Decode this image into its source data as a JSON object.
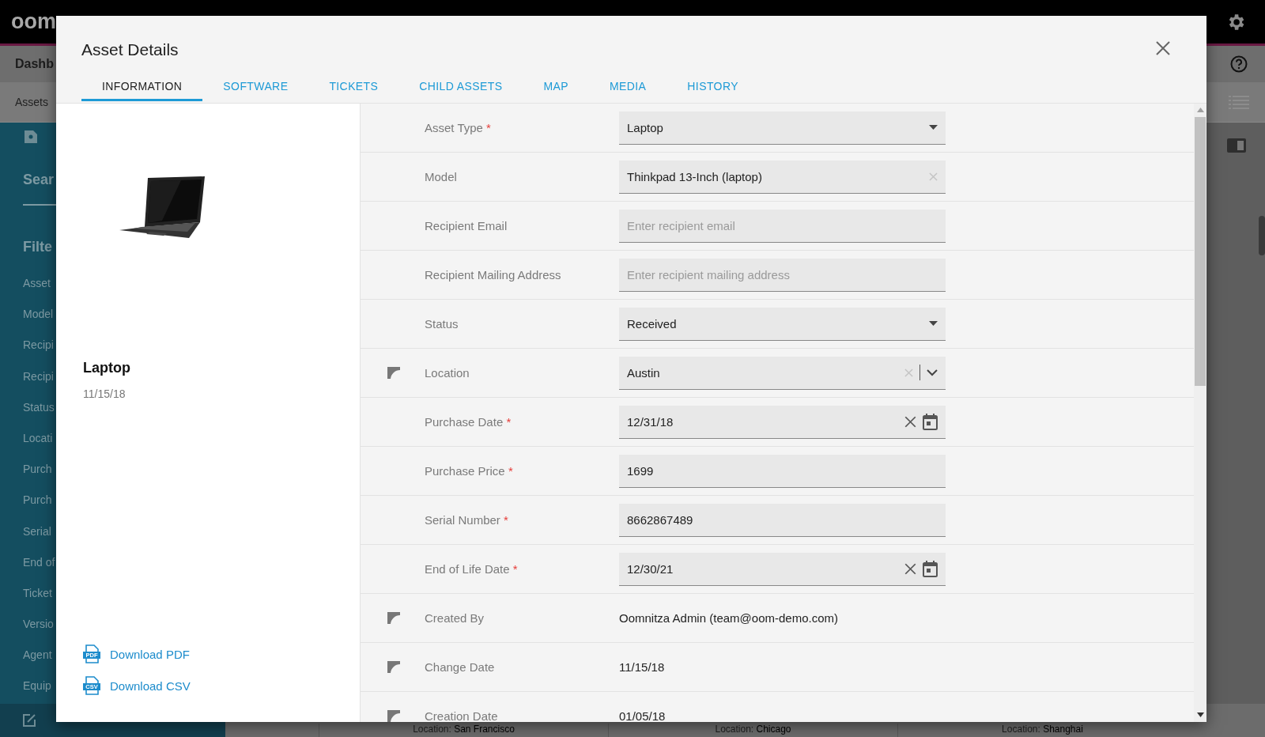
{
  "background": {
    "logo": "oom",
    "header_title": "Dashb",
    "breadcrumb": "Assets",
    "sidebar": {
      "search_heading": "Sear",
      "filter_heading": "Filte",
      "items": [
        "Asset",
        "Model",
        "Recipi",
        "Recipi",
        "Status",
        "Locati",
        "Purch",
        "Purch",
        "Serial",
        "End of",
        "Ticket",
        "Versio",
        "Agent",
        "Equip"
      ]
    },
    "cards": [
      {
        "label": "Location:",
        "value": "San Francisco"
      },
      {
        "label": "Location:",
        "value": "Chicago"
      },
      {
        "label": "Location:",
        "value": "Shanghai"
      }
    ]
  },
  "modal": {
    "title": "Asset Details",
    "tabs": [
      {
        "label": "INFORMATION",
        "selected": true
      },
      {
        "label": "SOFTWARE",
        "selected": false
      },
      {
        "label": "TICKETS",
        "selected": false
      },
      {
        "label": "CHILD ASSETS",
        "selected": false
      },
      {
        "label": "MAP",
        "selected": false
      },
      {
        "label": "MEDIA",
        "selected": false
      },
      {
        "label": "HISTORY",
        "selected": false
      }
    ],
    "asset": {
      "name": "Laptop",
      "date": "11/15/18"
    },
    "downloads": [
      {
        "badge": "PDF",
        "label": "Download PDF"
      },
      {
        "badge": "CSV",
        "label": "Download CSV"
      }
    ],
    "fields": [
      {
        "kind": "select",
        "label": "Asset Type",
        "required_mark": "*",
        "flagged": false,
        "value": "Laptop"
      },
      {
        "kind": "clearable",
        "label": "Model",
        "flagged": false,
        "value": "Thinkpad 13-Inch (laptop)"
      },
      {
        "kind": "text",
        "label": "Recipient Email",
        "flagged": false,
        "placeholder": "Enter recipient email"
      },
      {
        "kind": "text",
        "label": "Recipient Mailing Address",
        "flagged": false,
        "placeholder": "Enter recipient mailing address"
      },
      {
        "kind": "select",
        "label": "Status",
        "flagged": false,
        "value": "Received"
      },
      {
        "kind": "combo",
        "label": "Location",
        "flagged": true,
        "value": "Austin"
      },
      {
        "kind": "date",
        "label": "Purchase Date",
        "required_mark": "*",
        "flagged": false,
        "value": "12/31/18"
      },
      {
        "kind": "text",
        "label": "Purchase Price",
        "required_mark": "*",
        "flagged": false,
        "value": "1699"
      },
      {
        "kind": "text",
        "label": "Serial Number",
        "required_mark": "*",
        "flagged": false,
        "value": "8662867489"
      },
      {
        "kind": "date",
        "label": "End of Life Date",
        "required_mark": "*",
        "flagged": false,
        "value": "12/30/21"
      },
      {
        "kind": "static",
        "label": "Created By",
        "flagged": true,
        "value": "Oomnitza Admin (team@oom-demo.com)"
      },
      {
        "kind": "static",
        "label": "Change Date",
        "flagged": true,
        "value": "11/15/18"
      },
      {
        "kind": "static",
        "label": "Creation Date",
        "flagged": true,
        "value": "01/05/18"
      }
    ]
  }
}
